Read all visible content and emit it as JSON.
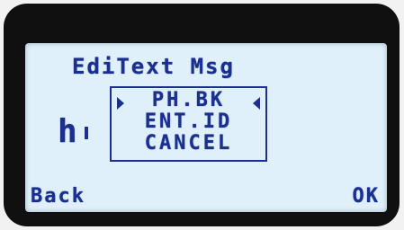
{
  "screen": {
    "title": "EdiText Msg",
    "input_text": "h",
    "colors": {
      "lcd_background": "#dff0fb",
      "lcd_text": "#1b2f8e",
      "bezel": "#101010"
    }
  },
  "menu": {
    "items": [
      "PH.BK",
      "ENT.ID",
      "CANCEL"
    ],
    "selected_index": 0
  },
  "softkeys": {
    "left": "Back",
    "right": "OK"
  }
}
